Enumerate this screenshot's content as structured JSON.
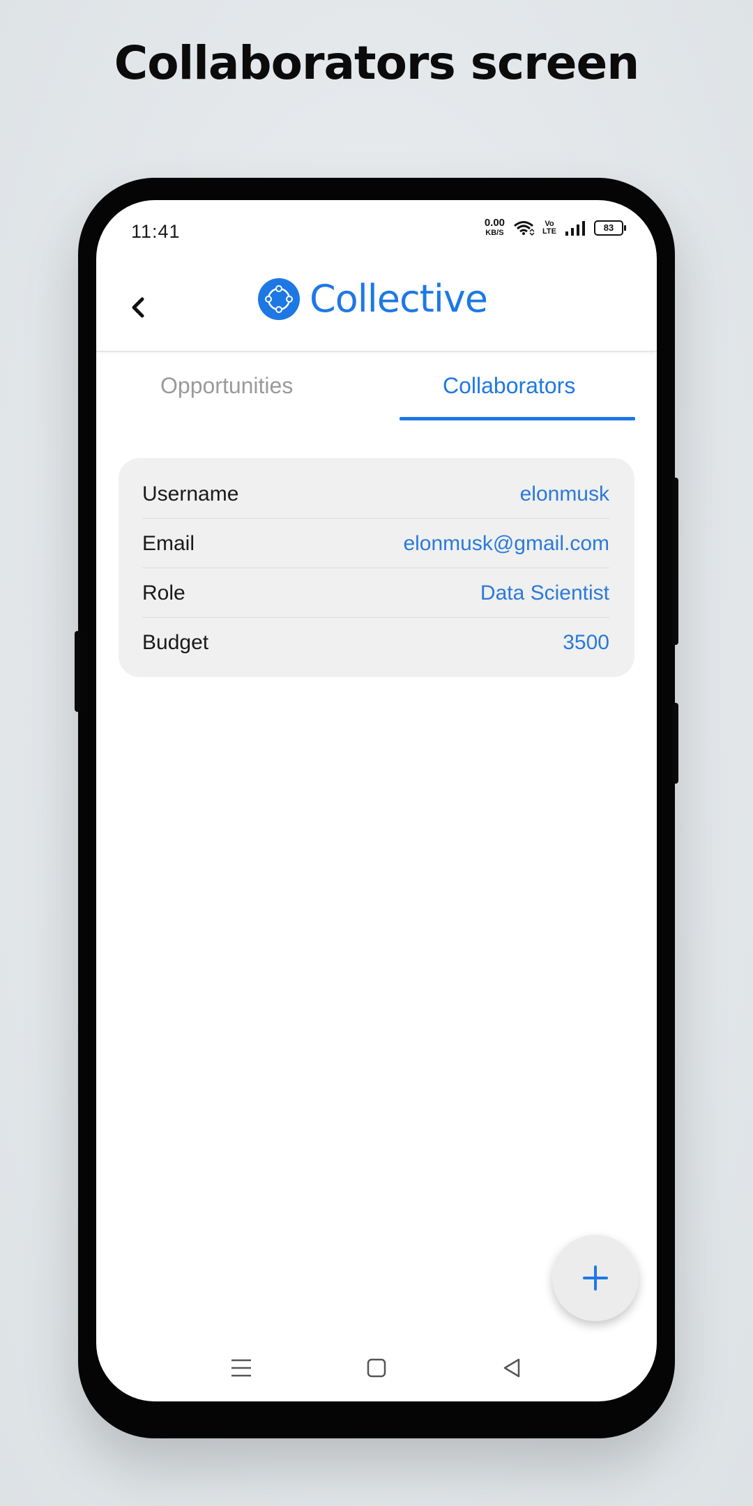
{
  "heading": "Collaborators screen",
  "status_bar": {
    "time": "11:41",
    "speed_value": "0.00",
    "speed_unit": "KB/S",
    "volte_top": "Vo",
    "volte_bottom": "LTE",
    "battery": "83",
    "icons": [
      "wifi-icon",
      "volte-icon",
      "signal-icon",
      "battery-icon"
    ]
  },
  "app_bar": {
    "back_icon": "chevron-left-icon",
    "logo_icon": "collective-logo-icon",
    "brand_name": "Collective"
  },
  "tabs": [
    {
      "label": "Opportunities",
      "active": false
    },
    {
      "label": "Collaborators",
      "active": true
    }
  ],
  "collaborator": {
    "rows": [
      {
        "label": "Username",
        "value": "elonmusk"
      },
      {
        "label": "Email",
        "value": "elonmusk@gmail.com"
      },
      {
        "label": "Role",
        "value": "Data Scientist"
      },
      {
        "label": "Budget",
        "value": "3500"
      }
    ]
  },
  "fab": {
    "icon": "plus-icon"
  },
  "nav_bar": {
    "icons": [
      "menu-icon",
      "home-square-icon",
      "back-triangle-icon"
    ]
  },
  "colors": {
    "accent": "#1e78e4",
    "card_bg": "#f0f0f0",
    "inactive_tab": "#9a9a9a"
  }
}
